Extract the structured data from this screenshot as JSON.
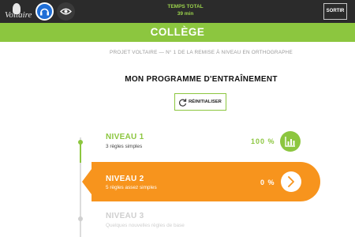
{
  "header": {
    "logo_text": "Voltaire",
    "total_label": "TEMPS TOTAL",
    "total_value": "39 min",
    "logout_label": "SORTIR"
  },
  "banner": {
    "title": "COLLÈGE"
  },
  "intro": {
    "subtitle": "PROJET VOLTAIRE — N° 1 DE LA REMISE À NIVEAU EN ORTHOGRAPHE",
    "heading": "MON PROGRAMME D'ENTRAÎNEMENT",
    "reset_label": "RÉINITIALISER"
  },
  "levels": [
    {
      "title": "NIVEAU 1",
      "subtitle": "3 règles simples",
      "progress": "100 %",
      "state": "completed",
      "icon": "chart-icon"
    },
    {
      "title": "NIVEAU 2",
      "subtitle": "5 règles assez simples",
      "progress": "0 %",
      "state": "current",
      "icon": "arrow-right-icon"
    },
    {
      "title": "NIVEAU 3",
      "subtitle": "Quelques nouvelles règles de base",
      "state": "locked"
    }
  ],
  "colors": {
    "green": "#8cc63f",
    "orange": "#f7941d",
    "dark": "#2b2b2b",
    "blue": "#1f6ed6"
  }
}
